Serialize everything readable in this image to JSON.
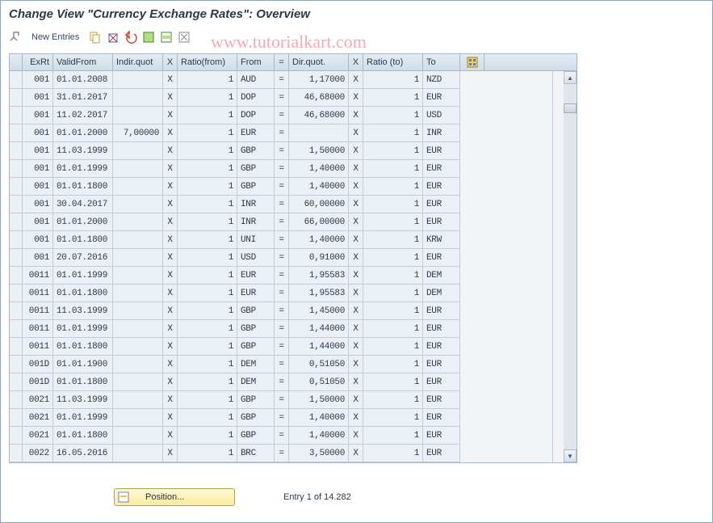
{
  "title": "Change View \"Currency Exchange Rates\": Overview",
  "watermark": "www.tutorialkart.com",
  "toolbar": {
    "new_entries_label": "New Entries"
  },
  "columns": {
    "exrt": "ExRt",
    "valid_from": "ValidFrom",
    "indir_quot": "Indir.quot",
    "x1": "X",
    "ratio_from": "Ratio(from)",
    "from": "From",
    "eq": "=",
    "dir_quot": "Dir.quot.",
    "x2": "X",
    "ratio_to": "Ratio (to)",
    "to": "To"
  },
  "rows": [
    {
      "exrt": "001",
      "valid": "01.01.2008",
      "indir": "",
      "x1": "X",
      "rfrom": "1",
      "from": "AUD",
      "eq": "=",
      "dir": "1,17000",
      "x2": "X",
      "rto": "1",
      "to": "NZD"
    },
    {
      "exrt": "001",
      "valid": "31.01.2017",
      "indir": "",
      "x1": "X",
      "rfrom": "1",
      "from": "DOP",
      "eq": "=",
      "dir": "46,68000",
      "x2": "X",
      "rto": "1",
      "to": "EUR"
    },
    {
      "exrt": "001",
      "valid": "11.02.2017",
      "indir": "",
      "x1": "X",
      "rfrom": "1",
      "from": "DOP",
      "eq": "=",
      "dir": "46,68000",
      "x2": "X",
      "rto": "1",
      "to": "USD"
    },
    {
      "exrt": "001",
      "valid": "01.01.2000",
      "indir": "7,00000",
      "x1": "X",
      "rfrom": "1",
      "from": "EUR",
      "eq": "=",
      "dir": "",
      "x2": "X",
      "rto": "1",
      "to": "INR",
      "indir_red": true
    },
    {
      "exrt": "001",
      "valid": "11.03.1999",
      "indir": "",
      "x1": "X",
      "rfrom": "1",
      "from": "GBP",
      "eq": "=",
      "dir": "1,50000",
      "x2": "X",
      "rto": "1",
      "to": "EUR"
    },
    {
      "exrt": "001",
      "valid": "01.01.1999",
      "indir": "",
      "x1": "X",
      "rfrom": "1",
      "from": "GBP",
      "eq": "=",
      "dir": "1,40000",
      "x2": "X",
      "rto": "1",
      "to": "EUR"
    },
    {
      "exrt": "001",
      "valid": "01.01.1800",
      "indir": "",
      "x1": "X",
      "rfrom": "1",
      "from": "GBP",
      "eq": "=",
      "dir": "1,40000",
      "x2": "X",
      "rto": "1",
      "to": "EUR"
    },
    {
      "exrt": "001",
      "valid": "30.04.2017",
      "indir": "",
      "x1": "X",
      "rfrom": "1",
      "from": "INR",
      "eq": "=",
      "dir": "60,00000",
      "x2": "X",
      "rto": "1",
      "to": "EUR"
    },
    {
      "exrt": "001",
      "valid": "01.01.2000",
      "indir": "",
      "x1": "X",
      "rfrom": "1",
      "from": "INR",
      "eq": "=",
      "dir": "66,00000",
      "x2": "X",
      "rto": "1",
      "to": "EUR"
    },
    {
      "exrt": "001",
      "valid": "01.01.1800",
      "indir": "",
      "x1": "X",
      "rfrom": "1",
      "from": "UNI",
      "eq": "=",
      "dir": "1,40000",
      "x2": "X",
      "rto": "1",
      "to": "KRW"
    },
    {
      "exrt": "001",
      "valid": "20.07.2016",
      "indir": "",
      "x1": "X",
      "rfrom": "1",
      "from": "USD",
      "eq": "=",
      "dir": "0,91000",
      "x2": "X",
      "rto": "1",
      "to": "EUR"
    },
    {
      "exrt": "0011",
      "valid": "01.01.1999",
      "indir": "",
      "x1": "X",
      "rfrom": "1",
      "from": "EUR",
      "eq": "=",
      "dir": "1,95583",
      "x2": "X",
      "rto": "1",
      "to": "DEM"
    },
    {
      "exrt": "0011",
      "valid": "01.01.1800",
      "indir": "",
      "x1": "X",
      "rfrom": "1",
      "from": "EUR",
      "eq": "=",
      "dir": "1,95583",
      "x2": "X",
      "rto": "1",
      "to": "DEM"
    },
    {
      "exrt": "0011",
      "valid": "11.03.1999",
      "indir": "",
      "x1": "X",
      "rfrom": "1",
      "from": "GBP",
      "eq": "=",
      "dir": "1,45000",
      "x2": "X",
      "rto": "1",
      "to": "EUR"
    },
    {
      "exrt": "0011",
      "valid": "01.01.1999",
      "indir": "",
      "x1": "X",
      "rfrom": "1",
      "from": "GBP",
      "eq": "=",
      "dir": "1,44000",
      "x2": "X",
      "rto": "1",
      "to": "EUR"
    },
    {
      "exrt": "0011",
      "valid": "01.01.1800",
      "indir": "",
      "x1": "X",
      "rfrom": "1",
      "from": "GBP",
      "eq": "=",
      "dir": "1,44000",
      "x2": "X",
      "rto": "1",
      "to": "EUR"
    },
    {
      "exrt": "001D",
      "valid": "01.01.1900",
      "indir": "",
      "x1": "X",
      "rfrom": "1",
      "from": "DEM",
      "eq": "=",
      "dir": "0,51050",
      "x2": "X",
      "rto": "1",
      "to": "EUR"
    },
    {
      "exrt": "001D",
      "valid": "01.01.1800",
      "indir": "",
      "x1": "X",
      "rfrom": "1",
      "from": "DEM",
      "eq": "=",
      "dir": "0,51050",
      "x2": "X",
      "rto": "1",
      "to": "EUR"
    },
    {
      "exrt": "0021",
      "valid": "11.03.1999",
      "indir": "",
      "x1": "X",
      "rfrom": "1",
      "from": "GBP",
      "eq": "=",
      "dir": "1,50000",
      "x2": "X",
      "rto": "1",
      "to": "EUR"
    },
    {
      "exrt": "0021",
      "valid": "01.01.1999",
      "indir": "",
      "x1": "X",
      "rfrom": "1",
      "from": "GBP",
      "eq": "=",
      "dir": "1,40000",
      "x2": "X",
      "rto": "1",
      "to": "EUR"
    },
    {
      "exrt": "0021",
      "valid": "01.01.1800",
      "indir": "",
      "x1": "X",
      "rfrom": "1",
      "from": "GBP",
      "eq": "=",
      "dir": "1,40000",
      "x2": "X",
      "rto": "1",
      "to": "EUR"
    },
    {
      "exrt": "0022",
      "valid": "16.05.2016",
      "indir": "",
      "x1": "X",
      "rfrom": "1",
      "from": "BRC",
      "eq": "=",
      "dir": "3,50000",
      "x2": "X",
      "rto": "1",
      "to": "EUR"
    }
  ],
  "footer": {
    "position_label": "Position...",
    "entry_text": "Entry 1 of 14.282"
  }
}
